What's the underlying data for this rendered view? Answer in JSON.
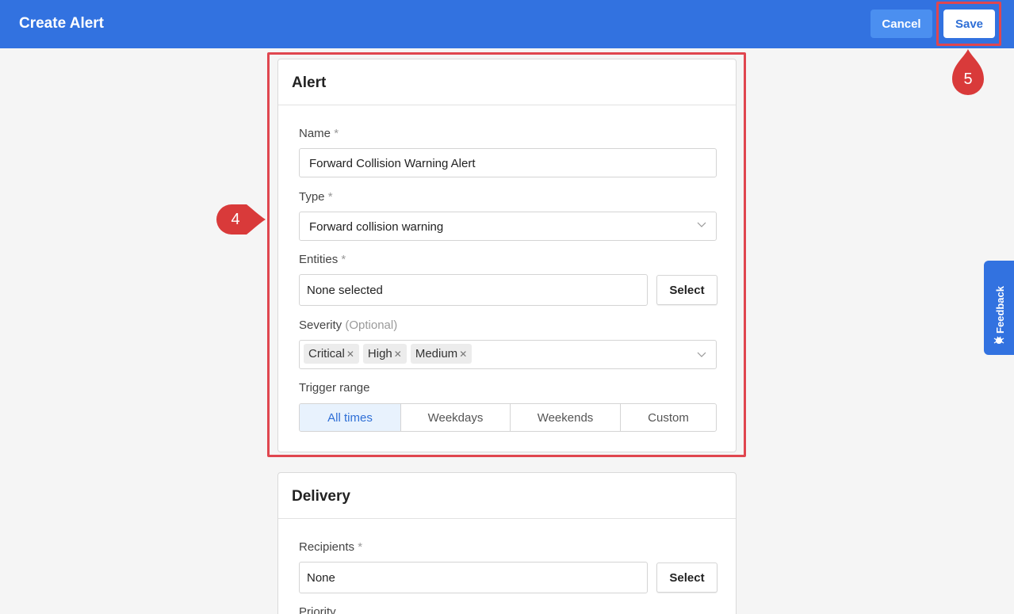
{
  "header": {
    "title": "Create Alert",
    "cancel_label": "Cancel",
    "save_label": "Save"
  },
  "markers": {
    "step_save": "5",
    "step_alert": "4"
  },
  "alert_card": {
    "title": "Alert",
    "name": {
      "label": "Name",
      "required": "*",
      "value": "Forward Collision Warning Alert"
    },
    "type": {
      "label": "Type",
      "required": "*",
      "value": "Forward collision warning"
    },
    "entities": {
      "label": "Entities",
      "required": "*",
      "value": "None selected",
      "select_label": "Select"
    },
    "severity": {
      "label": "Severity",
      "optional": "(Optional)",
      "tags": [
        "Critical",
        "High",
        "Medium"
      ]
    },
    "trigger_range": {
      "label": "Trigger range",
      "options": [
        "All times",
        "Weekdays",
        "Weekends",
        "Custom"
      ],
      "selected": "All times"
    }
  },
  "delivery_card": {
    "title": "Delivery",
    "recipients": {
      "label": "Recipients",
      "required": "*",
      "value": "None",
      "select_label": "Select"
    },
    "priority": {
      "label": "Priority"
    }
  },
  "feedback": {
    "label": "Feedback"
  },
  "colors": {
    "brand": "#3272e0",
    "highlight": "#e0464f",
    "marker": "#d93a3a"
  }
}
